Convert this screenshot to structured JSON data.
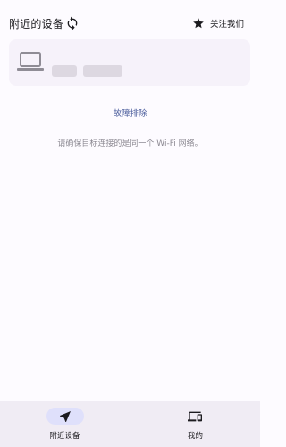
{
  "header": {
    "title": "附近的设备",
    "refresh_icon": "refresh-icon",
    "follow_icon": "star-icon",
    "follow_label": "关注我们"
  },
  "device_card": {
    "device_icon": "laptop-icon",
    "state": "loading"
  },
  "actions": {
    "troubleshoot_label": "故障排除"
  },
  "hint_text": "请确保目标连接的是同一个 Wi-Fi 网络。",
  "bottom_nav": {
    "items": [
      {
        "label": "附近设备",
        "icon": "navigation-arrow-icon",
        "selected": true
      },
      {
        "label": "我的",
        "icon": "devices-icon",
        "selected": false
      }
    ]
  },
  "colors": {
    "background": "#fdfbff",
    "card": "#f6f2fa",
    "accent_link": "#4b5d9c",
    "nav_bar": "#f0ecf4",
    "nav_pill": "#dfe0fb"
  }
}
